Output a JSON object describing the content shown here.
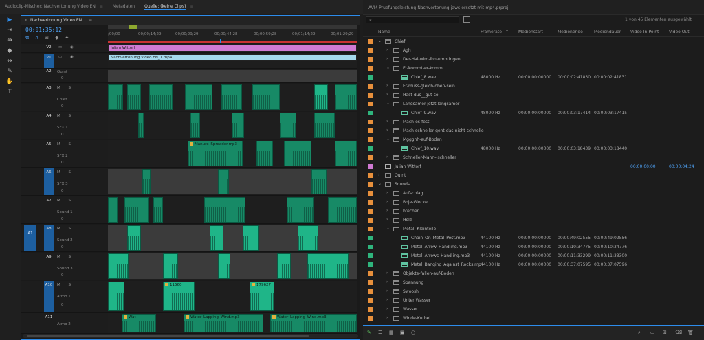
{
  "topbar": {
    "tabs": [
      "Audioclip-Mischer: Nachvertonung Video EN",
      "Metadaten",
      "Quelle: (keine Clips)"
    ]
  },
  "timeline": {
    "title": "Nachvertonung Video EN",
    "timecode": "00;01;35;12",
    "ruler": [
      ";00;00",
      "00;00;14;29",
      "00;00;29;29",
      "00;00;44;28",
      "00;00;59;28",
      "00;01;14;29",
      "00;01;29;29"
    ],
    "video_tracks": [
      {
        "id": "V2",
        "clip": "Julian Wittorf"
      },
      {
        "id": "V1",
        "clip": "Nachvertonung Video EN_1.mp4"
      }
    ],
    "audio_tracks": [
      {
        "id": "A2",
        "name": "Quint"
      },
      {
        "id": "A3",
        "name": "Chief"
      },
      {
        "id": "A4",
        "name": "SFX 1"
      },
      {
        "id": "A5",
        "name": "SFX 2",
        "clip": "Manure_Spreader.mp3"
      },
      {
        "id": "A6",
        "name": "SFX 3"
      },
      {
        "id": "A7",
        "name": "Sound 1"
      },
      {
        "id": "A8",
        "name": "Sound 2",
        "source": "A1"
      },
      {
        "id": "A9",
        "name": "Sound 3"
      },
      {
        "id": "A10",
        "name": "Atmo 1",
        "clip1": "11560",
        "clip2": "179627"
      },
      {
        "id": "A11",
        "name": "Atmo 2",
        "clip1": "Wat",
        "clip2": "Water_Lapping_Wind.mp3",
        "clip3": "Water_Lapping_Wind.mp3"
      }
    ],
    "controls": "M S",
    "vol": "0,"
  },
  "project": {
    "title": "AVM-Pruefungsleistung-Nachvertonung-jaws-ersetzt-mit-mp4.prproj",
    "count": "1 von 45 Elementen ausgewählt",
    "columns": [
      "Name",
      "Framerate",
      "Medienstart",
      "Medienende",
      "Mediendauer",
      "Video In-Point",
      "Video Out"
    ],
    "rows": [
      {
        "l": 0,
        "t": "folder",
        "n": "Chief",
        "open": true
      },
      {
        "l": 1,
        "t": "folder",
        "n": "Agh"
      },
      {
        "l": 1,
        "t": "folder",
        "n": "Der-Hai-wird-ihn-umbringen"
      },
      {
        "l": 1,
        "t": "folder",
        "n": "Er-kommt-er-kommt",
        "open": true
      },
      {
        "l": 2,
        "t": "audio",
        "n": "Chief_8.wav",
        "fr": "48000  Hz",
        "s": "00:00:00:00000",
        "e": "00:00:02:41830",
        "d": "00:00:02:41831"
      },
      {
        "l": 1,
        "t": "folder",
        "n": "Er-muss-gleich-oben-sein"
      },
      {
        "l": 1,
        "t": "folder",
        "n": "Hast-dus__gut-so"
      },
      {
        "l": 1,
        "t": "folder",
        "n": "Langsamer-jetzt-langsamer",
        "open": true
      },
      {
        "l": 2,
        "t": "audio",
        "n": "Chief_9.wav",
        "fr": "48000  Hz",
        "s": "00:00:00:00000",
        "e": "00:00:03:17414",
        "d": "00:00:03:17415"
      },
      {
        "l": 1,
        "t": "folder",
        "n": "Mach-es-fest"
      },
      {
        "l": 1,
        "t": "folder",
        "n": "Mach-schneller-geht-das-nicht-schnelle"
      },
      {
        "l": 1,
        "t": "folder",
        "n": "Mggghh-auf-Boden",
        "open": true
      },
      {
        "l": 2,
        "t": "audio",
        "n": "Chief_10.wav",
        "fr": "48000  Hz",
        "s": "00:00:00:00000",
        "e": "00:00:03:18439",
        "d": "00:00:03:18440"
      },
      {
        "l": 1,
        "t": "folder",
        "n": "Schneller-Mann--schneller"
      },
      {
        "l": 0,
        "t": "seq",
        "n": "Julian Wittorf",
        "c": "#d07ad3",
        "vi": "00:00:00:00",
        "vo": "00:00:04:24"
      },
      {
        "l": 0,
        "t": "folder",
        "n": "Quint"
      },
      {
        "l": 0,
        "t": "folder",
        "n": "Sounds",
        "open": true
      },
      {
        "l": 1,
        "t": "folder",
        "n": "Aufschlag"
      },
      {
        "l": 1,
        "t": "folder",
        "n": "Boje-Glocke"
      },
      {
        "l": 1,
        "t": "folder",
        "n": "brechen"
      },
      {
        "l": 1,
        "t": "folder",
        "n": "Holz"
      },
      {
        "l": 1,
        "t": "folder",
        "n": "Metall-Kleinteile",
        "open": true
      },
      {
        "l": 2,
        "t": "audio",
        "n": "Chain_On_Metal_Post.mp3",
        "fr": "44100  Hz",
        "s": "00:00:00:00000",
        "e": "00:00:49:02555",
        "d": "00:00:49:02556"
      },
      {
        "l": 2,
        "t": "audio",
        "n": "Metal_Arrow_Handling.mp3",
        "fr": "44100  Hz",
        "s": "00:00:00:00000",
        "e": "00:00:10:34775",
        "d": "00:00:10:34776"
      },
      {
        "l": 2,
        "t": "audio",
        "n": "Metal_Arrows_Handling.mp3",
        "fr": "44100  Hz",
        "s": "00:00:00:00000",
        "e": "00:00:11:33299",
        "d": "00:00:11:33300"
      },
      {
        "l": 2,
        "t": "audio",
        "n": "Metal_Banging_Against_Rocks.mp",
        "fr": "44100  Hz",
        "s": "00:00:00:00000",
        "e": "00:00:37:07595",
        "d": "00:00:37:07596"
      },
      {
        "l": 1,
        "t": "folder",
        "n": "Objekte-fallen-auf-Boden"
      },
      {
        "l": 1,
        "t": "folder",
        "n": "Spannung"
      },
      {
        "l": 1,
        "t": "folder",
        "n": "Swoosh"
      },
      {
        "l": 1,
        "t": "folder",
        "n": "Unter Wasser"
      },
      {
        "l": 1,
        "t": "folder",
        "n": "Wasser"
      },
      {
        "l": 1,
        "t": "folder",
        "n": "Winde-Kurbel"
      }
    ],
    "colors": {
      "folder": "#e8903c",
      "audio": "#2fb57d",
      "seq": "#d07ad3"
    }
  }
}
